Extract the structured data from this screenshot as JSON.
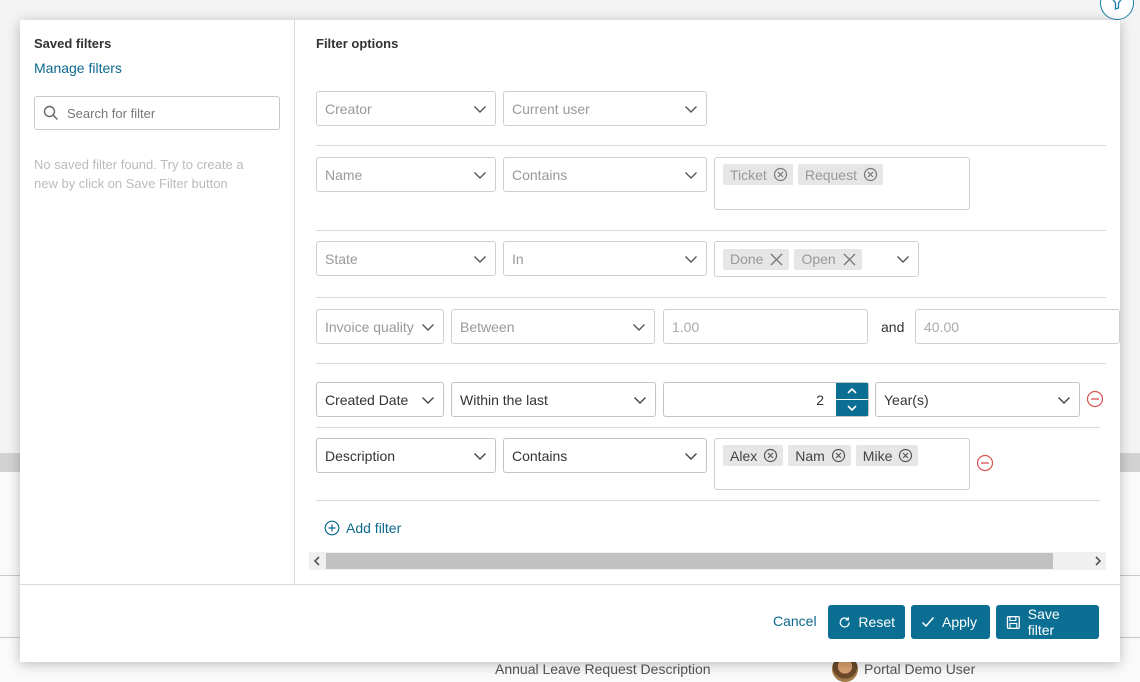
{
  "background": {
    "description_text": "Annual Leave Request Description",
    "user_name": "Portal Demo User"
  },
  "sidebar": {
    "title": "Saved filters",
    "manage_label": "Manage filters",
    "search_placeholder": "Search for filter",
    "empty_message": "No saved filter found. Try to create a new by click on Save Filter button"
  },
  "main": {
    "title": "Filter options",
    "rows": [
      {
        "field": "Creator",
        "operator": "Current user"
      },
      {
        "field": "Name",
        "operator": "Contains",
        "tags": [
          "Ticket",
          "Request"
        ]
      },
      {
        "field": "State",
        "operator": "In",
        "tags": [
          "Done",
          "Open"
        ]
      },
      {
        "field": "Invoice quality",
        "operator": "Between",
        "from": "1.00",
        "and_label": "and",
        "to": "40.00"
      },
      {
        "field": "Created Date",
        "operator": "Within the last",
        "amount": "2",
        "unit": "Year(s)"
      },
      {
        "field": "Description",
        "operator": "Contains",
        "tags": [
          "Alex",
          "Nam",
          "Mike"
        ]
      }
    ],
    "add_filter_label": "Add filter"
  },
  "footer": {
    "cancel_label": "Cancel",
    "reset_label": "Reset",
    "apply_label": "Apply",
    "save_label": "Save filter"
  },
  "colors": {
    "accent": "#0b6f93",
    "link": "#0d6a8e",
    "remove": "#d9534f"
  }
}
